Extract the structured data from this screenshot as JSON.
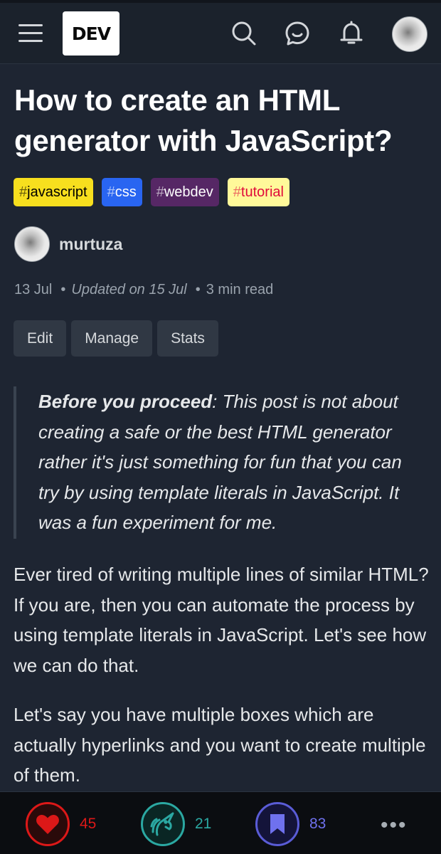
{
  "header": {
    "logo": "DEV"
  },
  "article": {
    "title": "How to create an HTML generator with JavaScript?",
    "tags": [
      {
        "name": "javascript"
      },
      {
        "name": "css"
      },
      {
        "name": "webdev"
      },
      {
        "name": "tutorial"
      }
    ],
    "author": "murtuza",
    "meta": {
      "date": "13 Jul",
      "updated": "Updated on 15 Jul",
      "read_time": "3 min read"
    },
    "actions": {
      "edit": "Edit",
      "manage": "Manage",
      "stats": "Stats"
    },
    "quote": {
      "bold": "Before you proceed",
      "text": ": This post is not about creating a safe or the best HTML generator rather it's just something for fun that you can try by using template literals in JavaScript. It was a fun experiment for me."
    },
    "paragraphs": [
      "Ever tired of writing multiple lines of similar HTML? If you are, then you can automate the process by using template literals in JavaScript. Let's see how we can do that.",
      "Let's say you have multiple boxes which are actually hyperlinks and you want to create multiple of them."
    ]
  },
  "bottom_bar": {
    "hearts": "45",
    "unicorns": "21",
    "saves": "83",
    "more": "•••"
  },
  "colors": {
    "background": "#1e2532",
    "tag_javascript": "#f7df1e",
    "tag_css": "#2965f1",
    "tag_webdev": "#562765",
    "tag_tutorial": "#fff99a",
    "heart": "#dc1818",
    "unicorn": "#2ba8a2",
    "save": "#5a5cd6"
  }
}
